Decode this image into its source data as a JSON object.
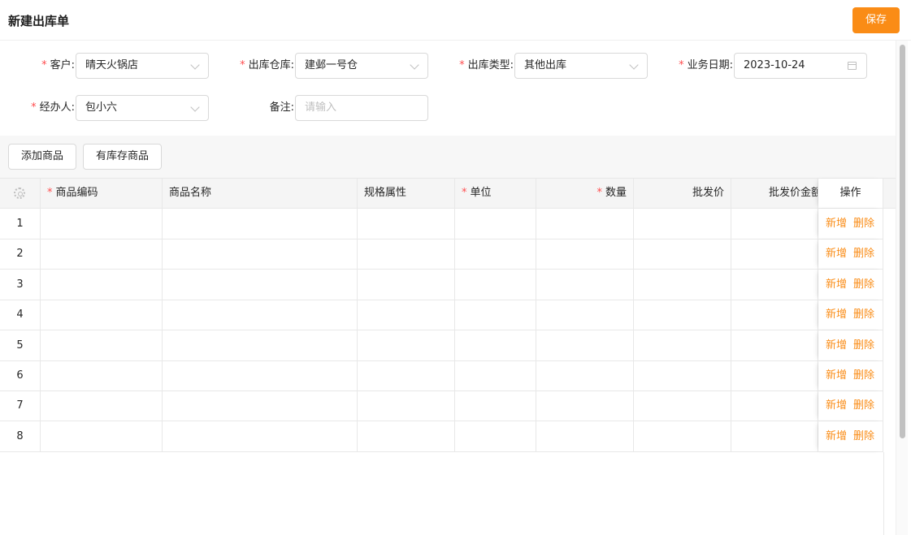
{
  "header": {
    "title": "新建出库单",
    "save_label": "保存"
  },
  "form": {
    "customer": {
      "label": "客户",
      "value": "晴天火锅店"
    },
    "warehouse": {
      "label": "出库仓库",
      "value": "建邺一号仓"
    },
    "out_type": {
      "label": "出库类型",
      "value": "其他出库"
    },
    "biz_date": {
      "label": "业务日期",
      "value": "2023-10-24"
    },
    "handler": {
      "label": "经办人",
      "value": "包小六"
    },
    "remark": {
      "label": "备注",
      "placeholder": "请输入"
    }
  },
  "toolbar": {
    "add_goods": "添加商品",
    "stock_goods": "有库存商品"
  },
  "table": {
    "columns": {
      "code": "商品编码",
      "name": "商品名称",
      "spec": "规格属性",
      "unit": "单位",
      "qty": "数量",
      "price": "批发价",
      "amount": "批发价金额",
      "ops": "操作"
    },
    "rows": [
      "1",
      "2",
      "3",
      "4",
      "5",
      "6",
      "7",
      "8"
    ],
    "add_label": "新增",
    "delete_label": "删除"
  },
  "colors": {
    "accent": "#fa8c16",
    "required": "#ff4d4f"
  },
  "icons": [
    "chevron-down-icon",
    "calendar-icon",
    "gear-icon"
  ]
}
